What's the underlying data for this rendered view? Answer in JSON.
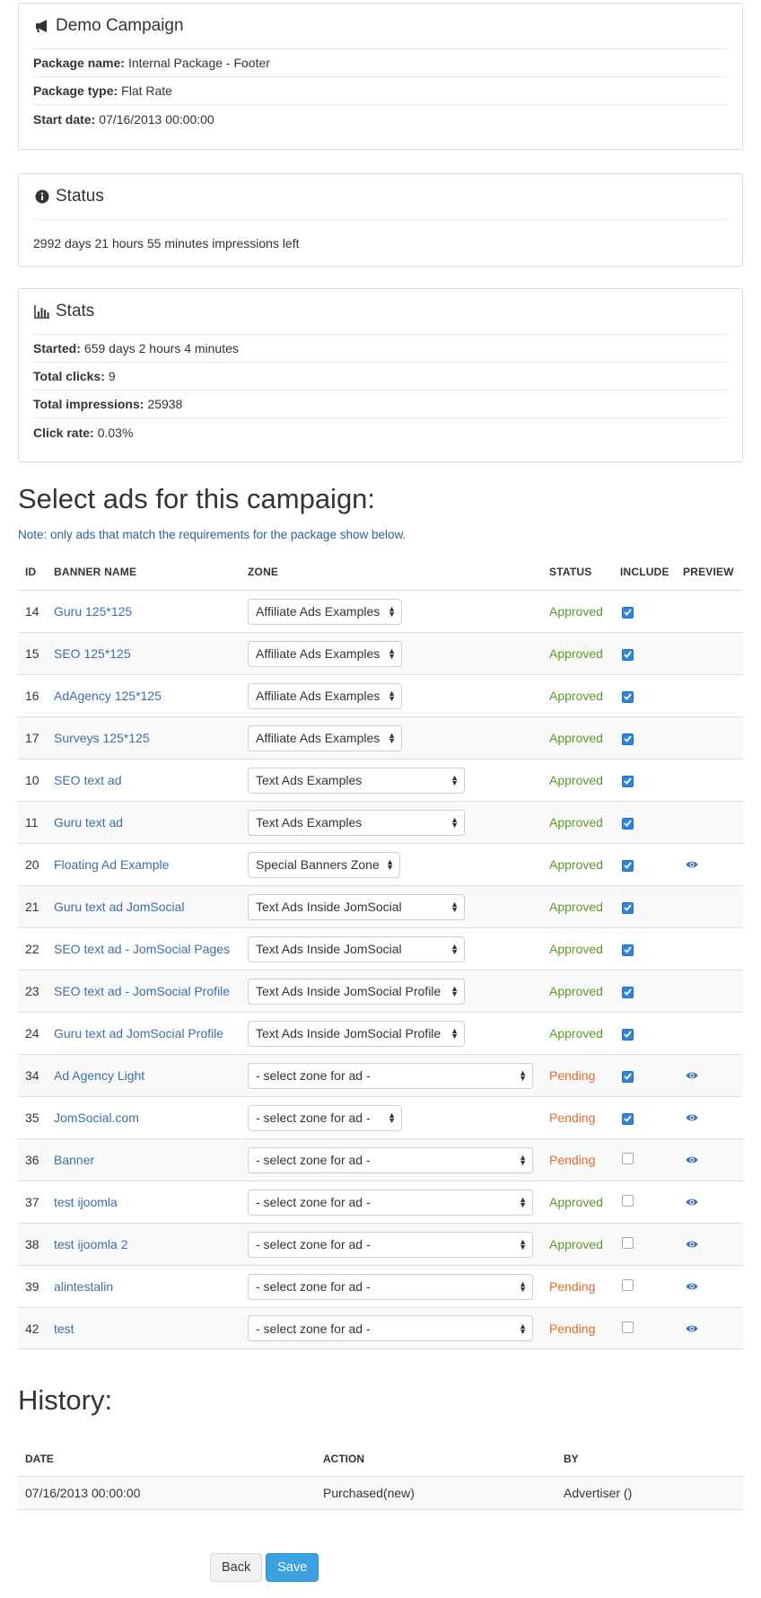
{
  "campaign": {
    "title": "Demo Campaign",
    "icon": "megaphone-icon",
    "rows": [
      {
        "label": "Package name:",
        "value": "Internal Package - Footer"
      },
      {
        "label": "Package type:",
        "value": "Flat Rate"
      },
      {
        "label": "Start date:",
        "value": "07/16/2013 00:00:00"
      }
    ]
  },
  "status": {
    "title": "Status",
    "icon": "info-circle-icon",
    "text": "2992 days 21 hours 55 minutes impressions left"
  },
  "stats": {
    "title": "Stats",
    "icon": "bar-chart-icon",
    "rows": [
      {
        "label": "Started:",
        "value": "659 days 2 hours 4 minutes"
      },
      {
        "label": "Total clicks:",
        "value": "9"
      },
      {
        "label": "Total impressions:",
        "value": "25938"
      },
      {
        "label": "Click rate:",
        "value": "0.03%"
      }
    ]
  },
  "select_ads": {
    "heading": "Select ads for this campaign:",
    "note": "Note: only ads that match the requirements for the package show below.",
    "columns": {
      "id": "ID",
      "name": "BANNER NAME",
      "zone": "ZONE",
      "status": "STATUS",
      "include": "INCLUDE",
      "preview": "PREVIEW"
    },
    "rows": [
      {
        "id": "14",
        "name": "Guru 125*125",
        "zone": "Affiliate Ads Examples",
        "status": "Approved",
        "include": true,
        "preview": false
      },
      {
        "id": "15",
        "name": "SEO 125*125",
        "zone": "Affiliate Ads Examples",
        "status": "Approved",
        "include": true,
        "preview": false
      },
      {
        "id": "16",
        "name": "AdAgency 125*125",
        "zone": "Affiliate Ads Examples",
        "status": "Approved",
        "include": true,
        "preview": false
      },
      {
        "id": "17",
        "name": "Surveys 125*125",
        "zone": "Affiliate Ads Examples",
        "status": "Approved",
        "include": true,
        "preview": false
      },
      {
        "id": "10",
        "name": "SEO text ad",
        "zone": "Text Ads Examples",
        "status": "Approved",
        "include": true,
        "preview": false
      },
      {
        "id": "11",
        "name": "Guru text ad",
        "zone": "Text Ads Examples",
        "status": "Approved",
        "include": true,
        "preview": false
      },
      {
        "id": "20",
        "name": "Floating Ad Example",
        "zone": "Special Banners Zone",
        "status": "Approved",
        "include": true,
        "preview": true
      },
      {
        "id": "21",
        "name": "Guru text ad JomSocial",
        "zone": "Text Ads Inside JomSocial",
        "status": "Approved",
        "include": true,
        "preview": false
      },
      {
        "id": "22",
        "name": "SEO text ad - JomSocial Pages",
        "zone": "Text Ads Inside JomSocial",
        "status": "Approved",
        "include": true,
        "preview": false
      },
      {
        "id": "23",
        "name": "SEO text ad - JomSocial Profile",
        "zone": "Text Ads Inside JomSocial Profile",
        "status": "Approved",
        "include": true,
        "preview": false
      },
      {
        "id": "24",
        "name": "Guru text ad JomSocial Profile",
        "zone": "Text Ads Inside JomSocial Profile",
        "status": "Approved",
        "include": true,
        "preview": false
      },
      {
        "id": "34",
        "name": "Ad Agency Light",
        "zone": "- select zone for ad -",
        "status": "Pending",
        "include": true,
        "preview": true
      },
      {
        "id": "35",
        "name": "JomSocial.com",
        "zone": "- select zone for ad -",
        "status": "Pending",
        "include": true,
        "preview": true
      },
      {
        "id": "36",
        "name": "Banner",
        "zone": "- select zone for ad -",
        "status": "Pending",
        "include": false,
        "preview": true
      },
      {
        "id": "37",
        "name": "test ijoomla",
        "zone": "- select zone for ad -",
        "status": "Approved",
        "include": false,
        "preview": true
      },
      {
        "id": "38",
        "name": "test ijoomla 2",
        "zone": "- select zone for ad -",
        "status": "Approved",
        "include": false,
        "preview": true
      },
      {
        "id": "39",
        "name": "alintestalin",
        "zone": "- select zone for ad -",
        "status": "Pending",
        "include": false,
        "preview": true
      },
      {
        "id": "42",
        "name": "test",
        "zone": "- select zone for ad -",
        "status": "Pending",
        "include": false,
        "preview": true
      }
    ]
  },
  "history": {
    "heading": "History:",
    "columns": {
      "date": "DATE",
      "action": "ACTION",
      "by": "BY"
    },
    "rows": [
      {
        "date": "07/16/2013 00:00:00",
        "action": "Purchased(new)",
        "by": "Advertiser ()"
      }
    ]
  },
  "buttons": {
    "back": "Back",
    "save": "Save"
  },
  "colors": {
    "link": "#3b6fa8",
    "approved": "#5b9a2a",
    "pending": "#e46b2a",
    "primary": "#3ca1e0"
  }
}
